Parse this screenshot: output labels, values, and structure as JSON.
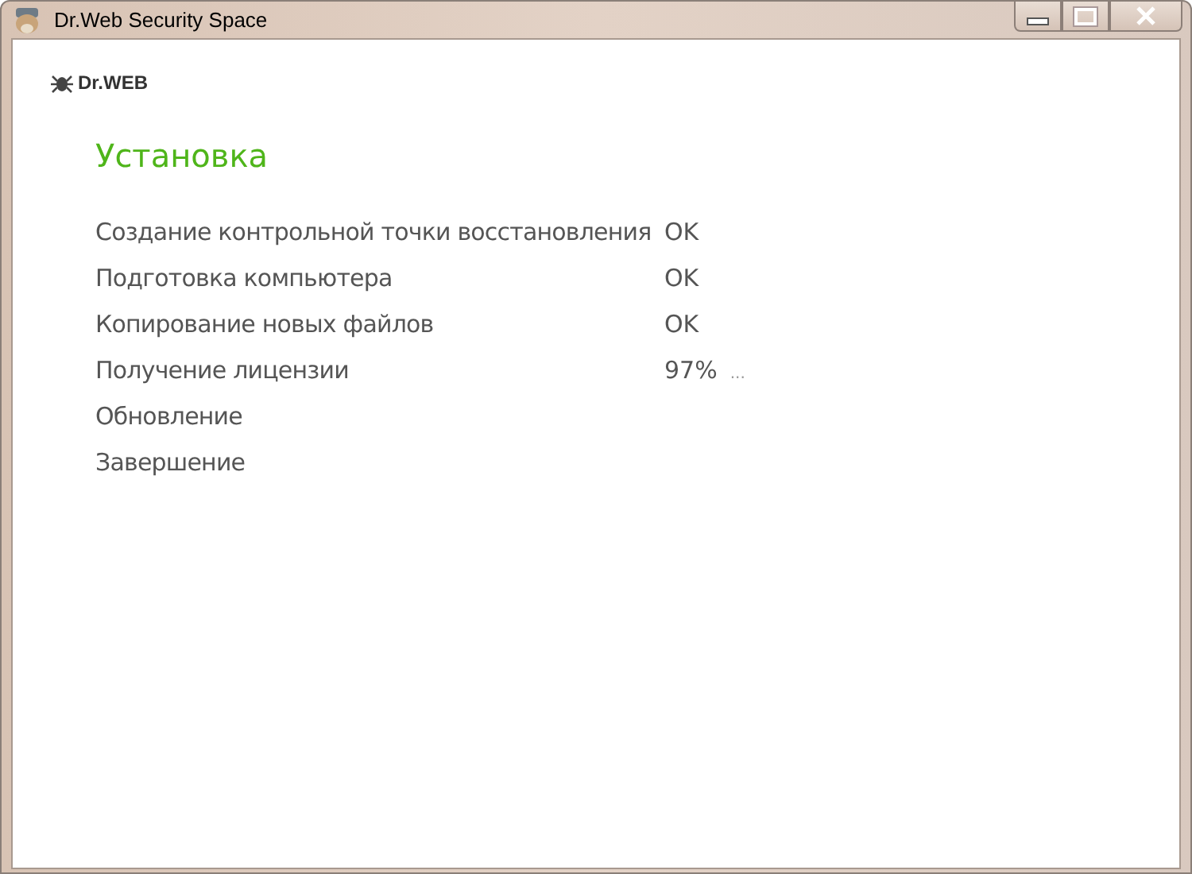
{
  "window": {
    "title": "Dr.Web Security Space"
  },
  "logo": {
    "text": "Dr.WEB"
  },
  "heading": "Установка",
  "steps": [
    {
      "label": "Создание контрольной точки восстановления",
      "status": "OK"
    },
    {
      "label": "Подготовка компьютера",
      "status": "OK"
    },
    {
      "label": "Копирование новых файлов",
      "status": "OK"
    },
    {
      "label": "Получение лицензии",
      "status": "97%",
      "activity": "..."
    },
    {
      "label": "Обновление"
    },
    {
      "label": "Завершение"
    }
  ]
}
